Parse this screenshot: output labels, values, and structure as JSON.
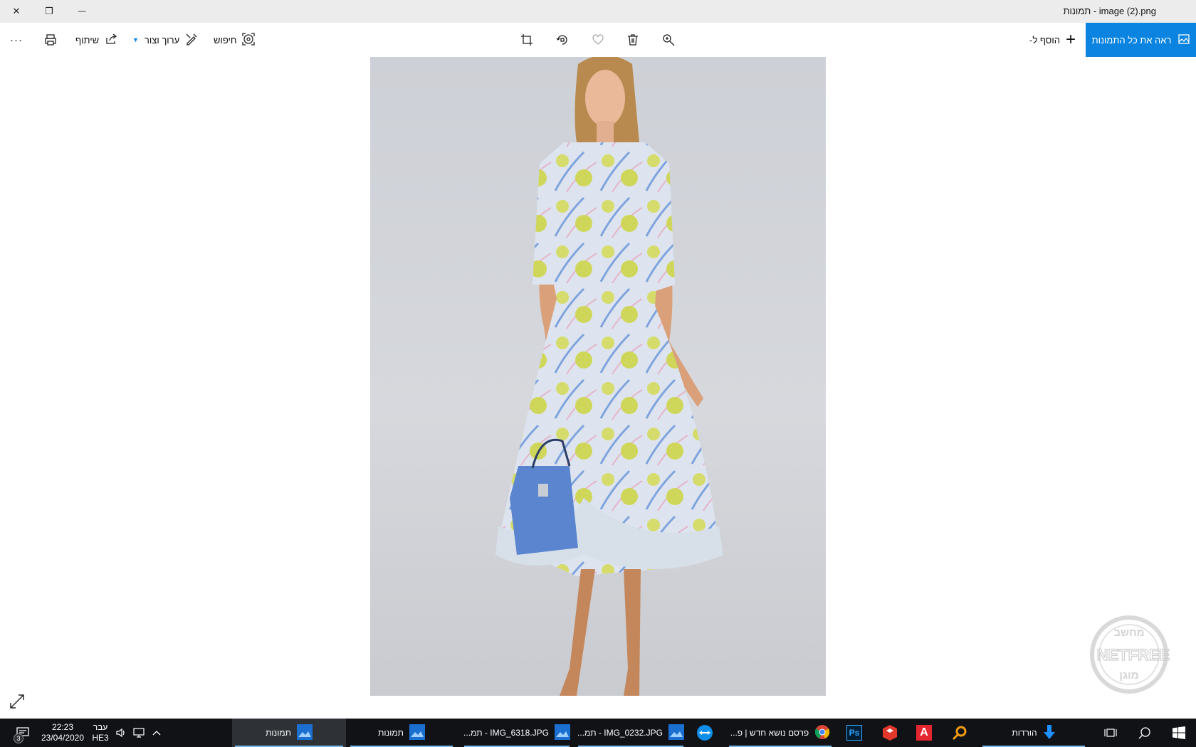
{
  "window": {
    "title": "image (2).png - תמונות",
    "close": "✕",
    "restore": "❐",
    "minimize": "—"
  },
  "toolbar": {
    "more": "···",
    "share_label": "שיתוף",
    "edit_label": "ערוך וצור",
    "search_label": "חיפוש",
    "add_to_label": "הוסף ל-",
    "see_all_label": "ראה את כל התמונות"
  },
  "watermark": {
    "text": "NETFREE",
    "top_text": "מחשב",
    "bottom_text": "מוגן"
  },
  "taskbar": {
    "tasks": [
      {
        "label": "הורדות",
        "icon": "download-arrow-icon"
      },
      {
        "label": "פרסם נושא חדש | פ...",
        "icon": "chrome-icon"
      },
      {
        "label": "IMG_0232.JPG - תמ...",
        "icon": "photos-icon"
      },
      {
        "label": "IMG_6318.JPG - תמ...",
        "icon": "photos-icon"
      },
      {
        "label": "תמונות",
        "icon": "photos-icon"
      },
      {
        "label": "תמונות",
        "icon": "photos-icon"
      }
    ],
    "pinned": [
      "photoshop-icon",
      "sketchup-icon",
      "acrobat-icon",
      "search-magnifier-app-icon",
      "teamviewer-icon"
    ],
    "ps_text": "Ps",
    "acrobat_text": "A",
    "lang_top": "עבר",
    "lang_bottom": "HE3",
    "time": "22:23",
    "date": "23/04/2020",
    "notifications_count": "3"
  },
  "colors": {
    "accent": "#0a84e0",
    "taskbar": "#101216",
    "titlebar": "#ececec"
  }
}
